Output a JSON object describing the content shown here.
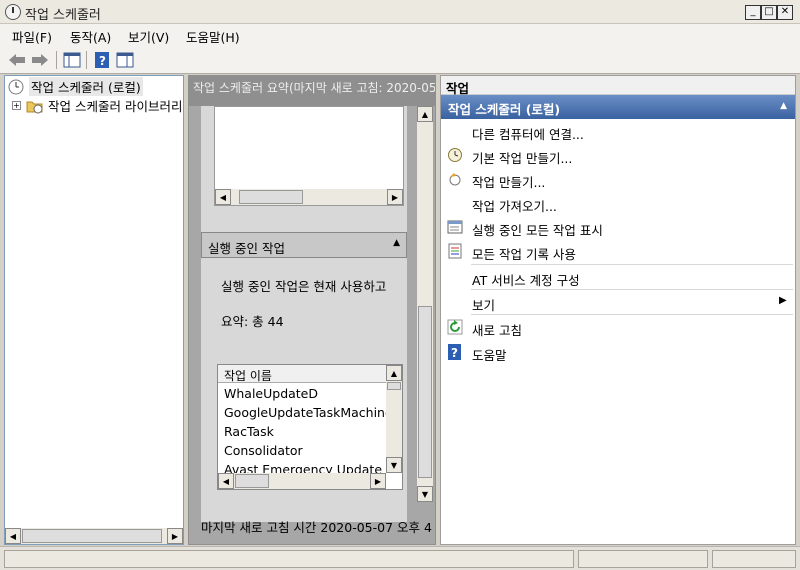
{
  "window": {
    "title": "작업 스케줄러"
  },
  "menu": {
    "items": [
      "파일(F)",
      "동작(A)",
      "보기(V)",
      "도움말(H)"
    ]
  },
  "tree": {
    "root": "작업 스케줄러 (로컬)",
    "child": "작업 스케줄러 라이브러리"
  },
  "middle": {
    "header": "작업 스케줄러 요약(마지막 새로 고침: 2020-05",
    "section_title": "실행 중인 작업",
    "section_text": "실행 중인 작업은 현재 사용하고",
    "summary": "요약: 총 44",
    "list_header": "작업 이름",
    "tasks": [
      "WhaleUpdateD",
      "GoogleUpdateTaskMachineUA",
      "RacTask",
      "Consolidator",
      "Avast Emergency Update"
    ],
    "footer": "마지막 새로 고침 시간 2020-05-07 오후 4:"
  },
  "actions": {
    "pane_title": "작업",
    "group_title": "작업 스케줄러 (로컬)",
    "items": [
      {
        "label": "다른 컴퓨터에 연결...",
        "icon": "none"
      },
      {
        "label": "기본 작업 만들기...",
        "icon": "wizard-icon"
      },
      {
        "label": "작업 만들기...",
        "icon": "create-task-icon"
      },
      {
        "label": "작업 가져오기...",
        "icon": "none"
      },
      {
        "label": "실행 중인 모든 작업 표시",
        "icon": "running-tasks-icon"
      },
      {
        "label": "모든 작업 기록 사용",
        "icon": "history-icon"
      },
      {
        "label": "AT 서비스 계정 구성",
        "icon": "none"
      },
      {
        "label": "보기",
        "icon": "none"
      },
      {
        "label": "새로 고침",
        "icon": "refresh-icon"
      },
      {
        "label": "도움말",
        "icon": "help-icon"
      }
    ]
  },
  "colors": {
    "group_header_start": "#5a80b8",
    "group_header_end": "#3a62a0",
    "mid_header": "#8f8f8f"
  }
}
